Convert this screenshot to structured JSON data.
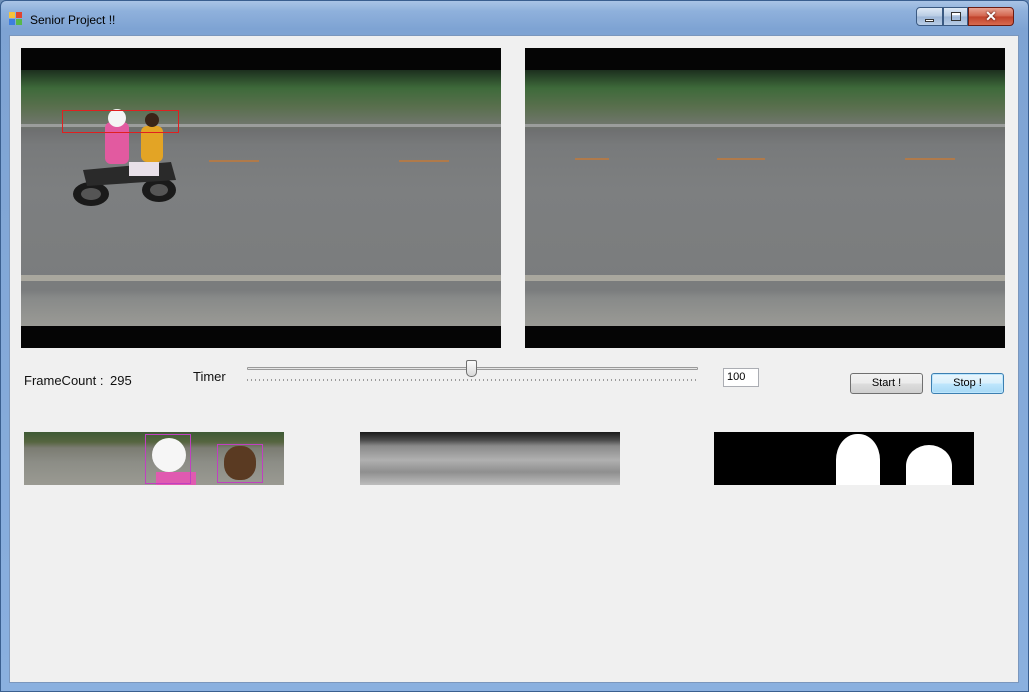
{
  "window": {
    "title": "Senior Project !!"
  },
  "controls": {
    "framecount_label": "FrameCount :",
    "framecount_value": "295",
    "timer_label": "Timer",
    "timer_level": 0.5,
    "interval_value": "100",
    "start_label": "Start !",
    "stop_label": "Stop !"
  },
  "colors": {
    "detection_box": "#e02020",
    "head_box": "#c040c0",
    "client_bg": "#f0f0f0"
  }
}
